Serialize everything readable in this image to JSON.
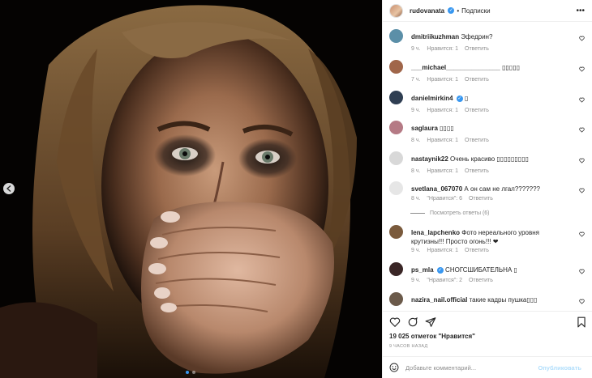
{
  "post": {
    "author": "rudovanata",
    "follow_label": "Подписки",
    "separator": "•",
    "more_label": "•••",
    "likes_text": "19 025 отметок \"Нравится\"",
    "time_text": "9 ЧАСОВ НАЗАД",
    "add_comment_placeholder": "Добавьте комментарий...",
    "publish_label": "Опубликовать"
  },
  "comments": [
    {
      "user": "dmitriikuzhman",
      "verified": false,
      "text": "Эфедрин?",
      "time": "9 ч.",
      "likes": "Нравится: 1",
      "reply": "Ответить",
      "avatar_color": "#5b8fa8"
    },
    {
      "user": "___michael_______________",
      "verified": false,
      "text": "▯▯▯▯▯",
      "time": "7 ч.",
      "likes": "Нравится: 1",
      "reply": "Ответить",
      "avatar_color": "#a0664a"
    },
    {
      "user": "danielmirkin4",
      "verified": true,
      "text": "▯",
      "time": "9 ч.",
      "likes": "Нравится: 1",
      "reply": "Ответить",
      "avatar_color": "#2f3e52"
    },
    {
      "user": "saglaura",
      "verified": false,
      "text": "▯▯▯▯",
      "time": "8 ч.",
      "likes": "Нравится: 1",
      "reply": "Ответить",
      "avatar_color": "#b57a85"
    },
    {
      "user": "nastaynik22",
      "verified": false,
      "text": "Очень красиво ▯▯▯▯▯▯▯▯▯",
      "time": "8 ч.",
      "likes": "Нравится: 1",
      "reply": "Ответить",
      "avatar_color": "#d8d8d8"
    },
    {
      "user": "svetlana_067070",
      "verified": false,
      "text": "А он сам не лгал???????",
      "time": "8 ч.",
      "likes": "\"Нравится\": 6",
      "reply": "Ответить",
      "avatar_color": "#e6e6e6"
    },
    {
      "user": "lena_lapchenko",
      "verified": false,
      "text": "Фото нереального уровня крутизны!!! Просто огонь!!! ❤",
      "time": "9 ч.",
      "likes": "Нравится: 1",
      "reply": "Ответить",
      "avatar_color": "#7a5a3c"
    },
    {
      "user": "ps_mla",
      "verified": true,
      "text": "СНОГСШИБАТЕЛЬНА ▯",
      "time": "9 ч.",
      "likes": "\"Нравится\": 2",
      "reply": "Ответить",
      "avatar_color": "#3a2626"
    },
    {
      "user": "nazira_nail.official",
      "verified": false,
      "text": "такие кадры пушка▯▯▯",
      "time": "",
      "likes": "",
      "reply": "",
      "avatar_color": "#6b5a4a"
    }
  ],
  "view_replies": "Посмотреть ответы (6)",
  "icons": {
    "heart": "heart-icon",
    "comment": "comment-icon",
    "share": "share-icon",
    "save": "bookmark-icon",
    "emoji": "emoji-icon",
    "prev": "chevron-left-icon"
  },
  "colors": {
    "accent": "#3897f0",
    "muted": "#8e8e8e",
    "publish_disabled": "#b2dffc"
  }
}
